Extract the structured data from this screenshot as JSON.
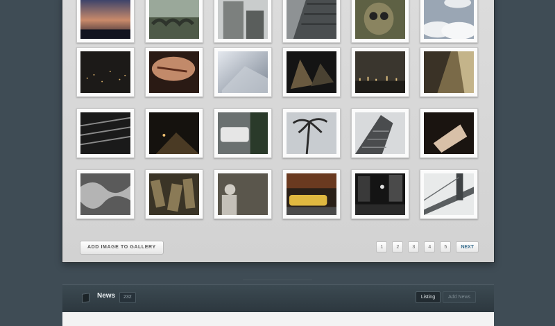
{
  "gallery": {
    "add_button_label": "ADD IMAGE TO GALLERY",
    "thumbnails": [
      {
        "icon": "sunset-photo-icon"
      },
      {
        "icon": "bridge-photo-icon"
      },
      {
        "icon": "building-photo-icon"
      },
      {
        "icon": "skyscraper-photo-icon"
      },
      {
        "icon": "owl-photo-icon"
      },
      {
        "icon": "clouds-photo-icon"
      },
      {
        "icon": "night-city-photo-icon"
      },
      {
        "icon": "dial-photo-icon"
      },
      {
        "icon": "airplane-photo-icon"
      },
      {
        "icon": "pyramid-photo-icon"
      },
      {
        "icon": "skyline-photo-icon"
      },
      {
        "icon": "street-photo-icon"
      },
      {
        "icon": "stairs-photo-icon"
      },
      {
        "icon": "road-photo-icon"
      },
      {
        "icon": "car-photo-icon"
      },
      {
        "icon": "palm-trees-photo-icon"
      },
      {
        "icon": "tower-photo-icon"
      },
      {
        "icon": "paper-photo-icon"
      },
      {
        "icon": "fabric-photo-icon"
      },
      {
        "icon": "crowd-photo-icon"
      },
      {
        "icon": "person-photo-icon"
      },
      {
        "icon": "taxi-photo-icon"
      },
      {
        "icon": "times-square-photo-icon"
      },
      {
        "icon": "bridge-photo-icon"
      }
    ]
  },
  "pagination": {
    "pages": [
      "1",
      "2",
      "3",
      "4",
      "5"
    ],
    "next_label": "NEXT"
  },
  "news": {
    "title": "News",
    "count": "232",
    "tabs": [
      {
        "label": "Listing",
        "active": true
      },
      {
        "label": "Add News",
        "active": false
      }
    ]
  }
}
